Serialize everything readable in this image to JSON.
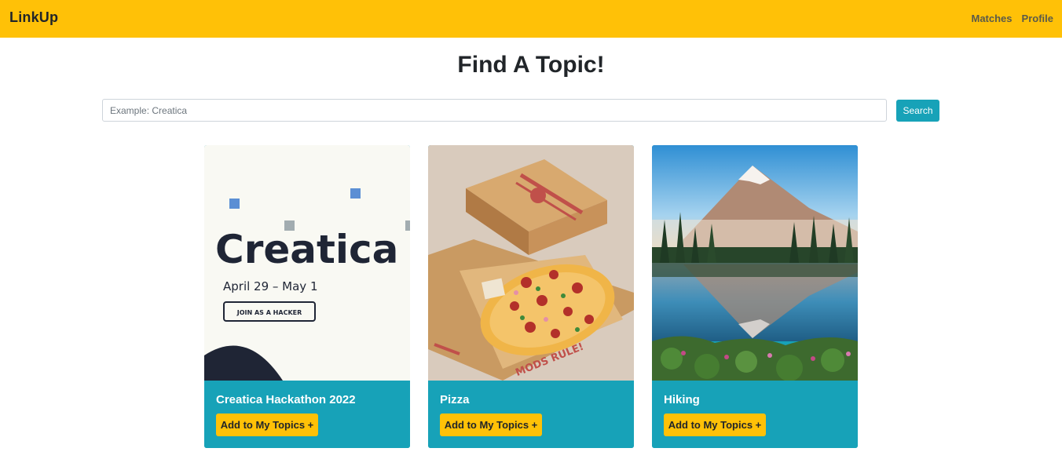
{
  "app": {
    "brand": "LinkUp"
  },
  "nav": {
    "links": [
      {
        "label": "Matches"
      },
      {
        "label": "Profile"
      }
    ]
  },
  "main": {
    "title": "Find A Topic!",
    "search": {
      "placeholder": "Example: Creatica",
      "value": "",
      "button_label": "Search"
    },
    "cards": [
      {
        "title": "Creatica Hackathon 2022",
        "button_label": "Add to My Topics +",
        "image": {
          "subject": "creatica-banner",
          "wordmark": "Creatica",
          "date_text": "April 29 – May 1",
          "cta_text": "JOIN AS A HACKER"
        }
      },
      {
        "title": "Pizza",
        "button_label": "Add to My Topics +",
        "image": {
          "subject": "pizza-box-illustration",
          "box_text": "MODS RULE!"
        }
      },
      {
        "title": "Hiking",
        "button_label": "Add to My Topics +",
        "image": {
          "subject": "mountain-lake-landscape"
        }
      }
    ]
  },
  "colors": {
    "navbar": "#ffc107",
    "accent": "#17a2b8",
    "button": "#ffc107",
    "text": "#212529"
  }
}
